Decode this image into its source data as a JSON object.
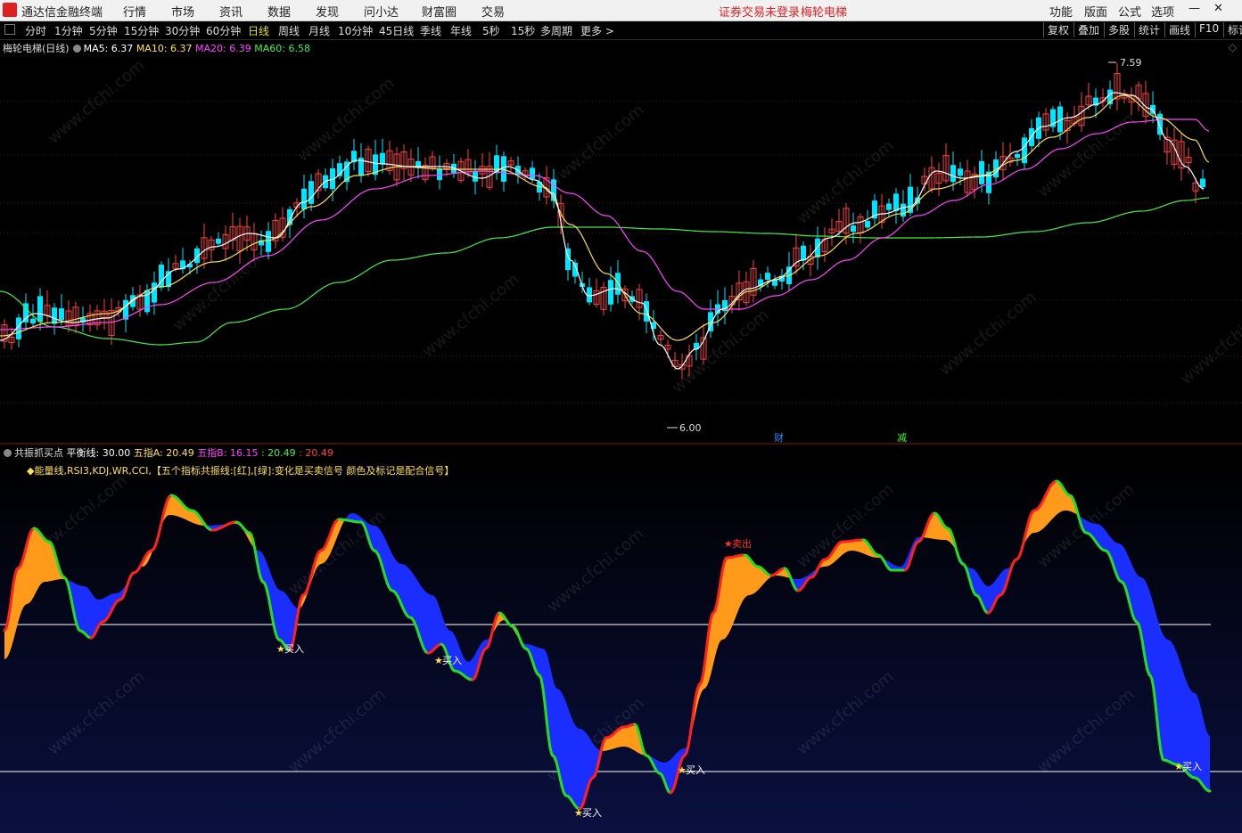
{
  "app": {
    "title": "通达信金融终端",
    "menu": [
      "行情",
      "市场",
      "资讯",
      "数据",
      "发现",
      "问小达",
      "财富圈",
      "交易"
    ],
    "status_login": "证券交易未登录",
    "stock_name": "梅轮电梯",
    "right_menu": [
      "功能",
      "版面",
      "公式",
      "选项"
    ]
  },
  "toolbar": {
    "periods": [
      "分时",
      "1分钟",
      "5分钟",
      "15分钟",
      "30分钟",
      "60分钟",
      "日线",
      "周线",
      "月线",
      "10分钟",
      "45日线",
      "季线",
      "年线",
      "5秒",
      "15秒",
      "多周期",
      "更多 >"
    ],
    "active": "日线",
    "right": [
      "复权",
      "叠加",
      "多股",
      "统计",
      "画线",
      "F10",
      "标记"
    ]
  },
  "main_chart": {
    "title": "梅轮电梯(日线)",
    "ma": [
      {
        "label": "MA5: 6.37",
        "color": "#ffffff"
      },
      {
        "label": "MA10: 6.37",
        "color": "#ffe14a"
      },
      {
        "label": "MA20: 6.39",
        "color": "#ff44ff"
      },
      {
        "label": "MA60: 6.58",
        "color": "#44ee44"
      }
    ],
    "high_label": "7.59",
    "low_label": "6.00",
    "markers": [
      "财",
      "减"
    ],
    "colors": {
      "up": "#ff4040",
      "down": "#00e5ff"
    }
  },
  "indicator": {
    "name": "共振抓买点",
    "values": [
      {
        "label": "平衡线: 30.00",
        "color": "#ffffff"
      },
      {
        "label": "五指A: 20.49",
        "color": "#ffe14a"
      },
      {
        "label": "五指B: 16.15",
        "color": "#ff44ff"
      },
      {
        "label": ": 20.49",
        "color": "#44ee44"
      },
      {
        "label": ": 20.49",
        "color": "#ff4040"
      }
    ],
    "description": "◆能量线,RSI3,KDJ,WR,CCI,【五个指标共振线:[红],[绿]:变化是买卖信号 颜色及标记是配合信号】",
    "buy_label": "买入",
    "sell_label": "卖出",
    "colors": {
      "orange": "#ff9a1a",
      "blue": "#1a2fff",
      "line_up": "#ff2020",
      "line_down": "#22dd22"
    }
  },
  "watermark": "www.cfchi.com"
}
